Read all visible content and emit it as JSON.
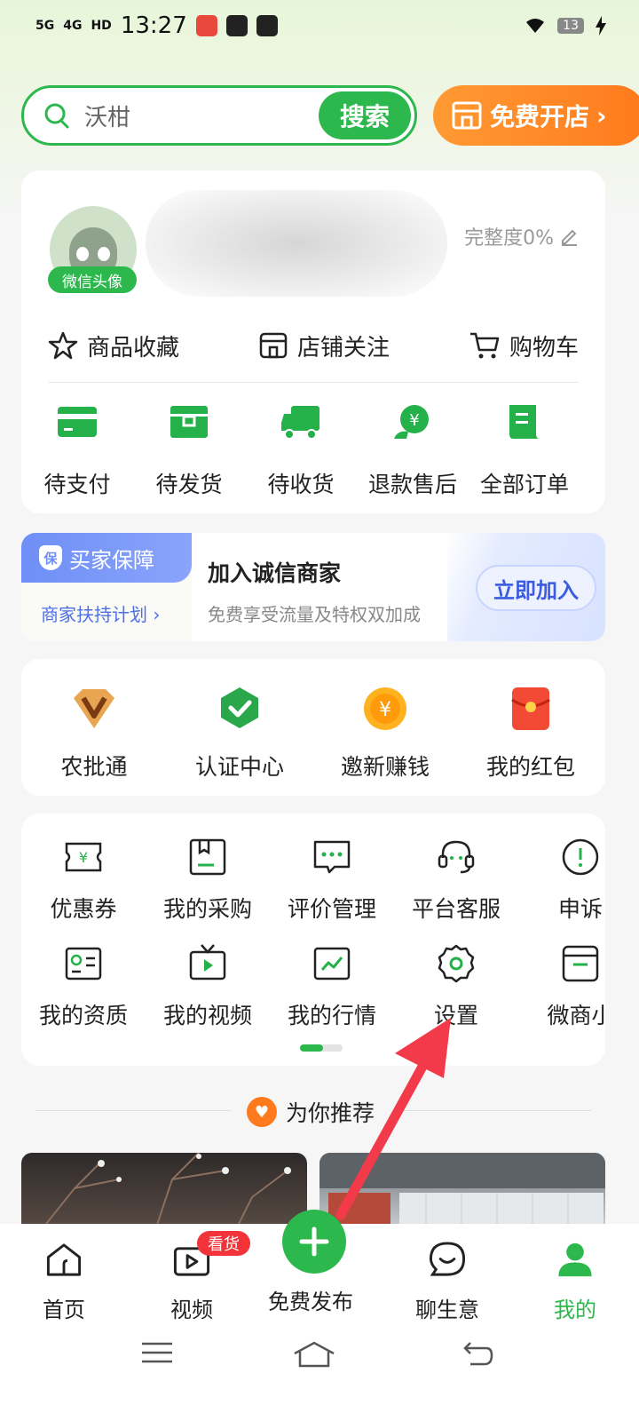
{
  "status_bar": {
    "time": "13:27",
    "network_1": "5G",
    "network_2": "4G",
    "hd": "HD",
    "battery": "13"
  },
  "search": {
    "placeholder": "沃柑",
    "button": "搜索"
  },
  "open_shop": {
    "label": "免费开店"
  },
  "profile": {
    "avatar_tag": "微信头像",
    "completeness": "完整度0%",
    "quick_links": [
      {
        "label": "商品收藏",
        "icon": "star-icon"
      },
      {
        "label": "店铺关注",
        "icon": "shop-icon"
      },
      {
        "label": "购物车",
        "icon": "cart-icon"
      }
    ],
    "orders": [
      {
        "label": "待支付",
        "icon": "card-icon"
      },
      {
        "label": "待发货",
        "icon": "box-icon"
      },
      {
        "label": "待收货",
        "icon": "truck-icon"
      },
      {
        "label": "退款售后",
        "icon": "refund-icon"
      },
      {
        "label": "全部订单",
        "icon": "order-list-icon"
      }
    ]
  },
  "banner": {
    "tag": "买家保障",
    "tag_icon_text": "保",
    "sub": "商家扶持计划",
    "title": "加入诚信商家",
    "desc": "免费享受流量及特权双加成",
    "button": "立即加入"
  },
  "services": [
    {
      "label": "农批通",
      "icon": "diamond-v-icon"
    },
    {
      "label": "认证中心",
      "icon": "certified-badge-icon"
    },
    {
      "label": "邀新赚钱",
      "icon": "coin-icon",
      "icon_text": "¥"
    },
    {
      "label": "我的红包",
      "icon": "red-envelope-icon"
    }
  ],
  "tools_row1": [
    {
      "label": "优惠券",
      "icon": "coupon-icon"
    },
    {
      "label": "我的采购",
      "icon": "purchase-icon"
    },
    {
      "label": "评价管理",
      "icon": "comment-icon"
    },
    {
      "label": "平台客服",
      "icon": "headset-icon"
    },
    {
      "label": "申诉",
      "icon": "alert-icon"
    }
  ],
  "tools_row2": [
    {
      "label": "我的资质",
      "icon": "id-card-icon"
    },
    {
      "label": "我的视频",
      "icon": "tv-icon"
    },
    {
      "label": "我的行情",
      "icon": "trend-chart-icon"
    },
    {
      "label": "设置",
      "icon": "gear-icon"
    },
    {
      "label": "微商小",
      "icon": "store-icon"
    }
  ],
  "recommend": {
    "label": "为你推荐"
  },
  "tabbar": [
    {
      "label": "首页",
      "icon": "home-icon"
    },
    {
      "label": "视频",
      "icon": "video-icon",
      "badge": "看货"
    },
    {
      "label": "免费发布",
      "icon": "plus-icon"
    },
    {
      "label": "聊生意",
      "icon": "chat-icon"
    },
    {
      "label": "我的",
      "icon": "user-icon"
    }
  ],
  "colors": {
    "brand_green": "#2db84d",
    "accent_orange": "#ff7a1c",
    "badge_red": "#f2333a",
    "annotation_red": "#f23a4b"
  }
}
